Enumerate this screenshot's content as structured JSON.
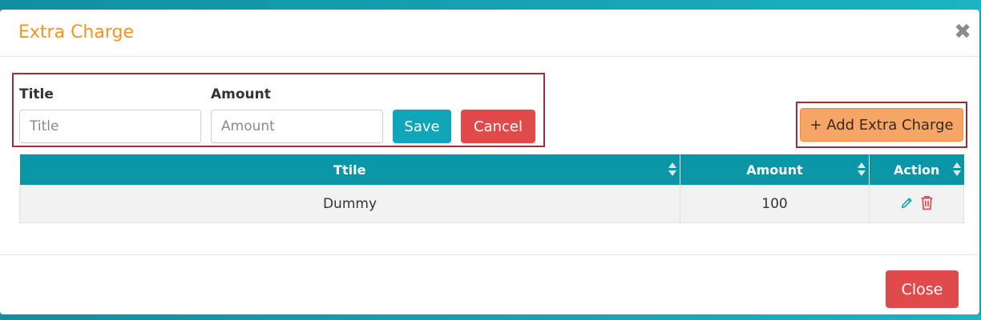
{
  "modal": {
    "title": "Extra Charge"
  },
  "form": {
    "title_label": "Title",
    "title_placeholder": "Title",
    "amount_label": "Amount",
    "amount_placeholder": "Amount",
    "save_label": "Save",
    "cancel_label": "Cancel"
  },
  "add_button_label": "+ Add Extra Charge",
  "table": {
    "columns": [
      "Ttile",
      "Amount",
      "Action"
    ],
    "rows": [
      {
        "title": "Dummy",
        "amount": "100"
      }
    ]
  },
  "footer": {
    "close_label": "Close"
  },
  "icons": {
    "close": "times-icon",
    "edit": "pencil-icon",
    "delete": "trash-icon",
    "sort": "sort-arrows-icon"
  },
  "colors": {
    "title": "#f7931e",
    "header_bg": "#0a96a6",
    "primary": "#10a5b8",
    "danger": "#e04a4a",
    "add": "#f7a467",
    "highlight": "#a32c33"
  }
}
